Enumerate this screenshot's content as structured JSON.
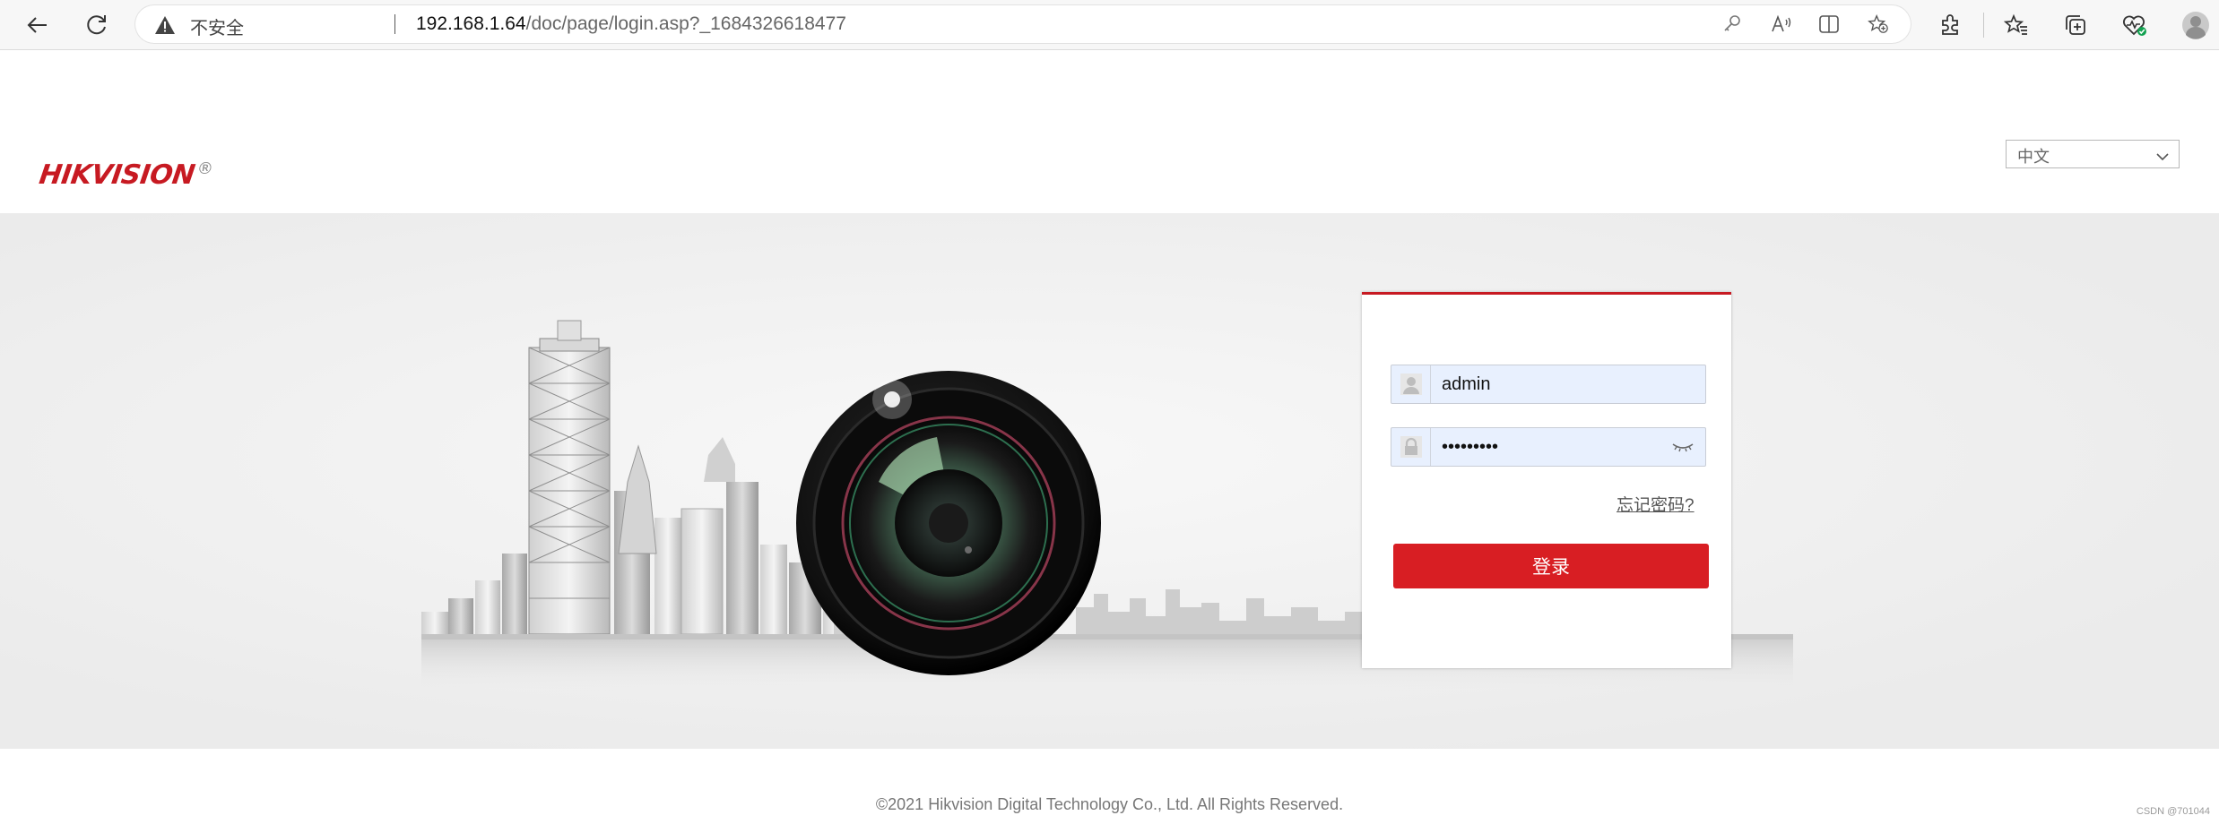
{
  "browser": {
    "security_label": "不安全",
    "url_host": "192.168.1.64",
    "url_path": "/doc/page/login.asp?_1684326618477",
    "icons": [
      "back-icon",
      "refresh-icon",
      "warning-icon",
      "key-icon",
      "read-aloud-icon",
      "split-screen-icon",
      "add-favorite-icon",
      "extensions-icon",
      "favorites-icon",
      "collections-icon",
      "browser-health-icon",
      "profile-icon"
    ]
  },
  "header": {
    "logo_text": "HIKVISION",
    "logo_reg": "®",
    "language": {
      "selected": "中文"
    }
  },
  "login": {
    "username": {
      "value": "admin"
    },
    "password": {
      "value": "*********"
    },
    "forgot_label": "忘记密码?",
    "login_label": "登录"
  },
  "footer": {
    "copyright": "©2021 Hikvision Digital Technology Co., Ltd. All Rights Reserved.",
    "watermark": "CSDN @701044"
  },
  "colors": {
    "brand_red": "#c71a22",
    "button_red": "#d81e23",
    "band_gray": "#efefef",
    "input_fill": "#e8f0fe"
  }
}
